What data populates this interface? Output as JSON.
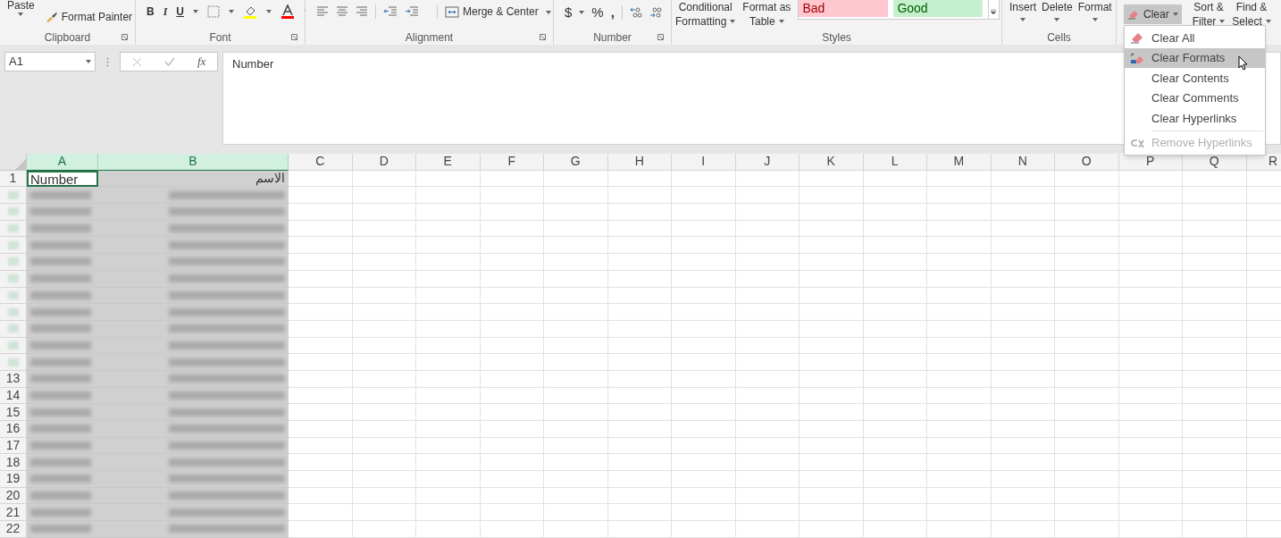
{
  "ribbon": {
    "clipboard": {
      "paste": "Paste",
      "format_painter": "Format Painter",
      "label": "Clipboard"
    },
    "font": {
      "bold": "B",
      "italic": "I",
      "underline": "U",
      "label": "Font"
    },
    "alignment": {
      "merge": "Merge & Center",
      "label": "Alignment"
    },
    "number": {
      "currency": "$",
      "percent": "%",
      "comma": ",",
      "label": "Number"
    },
    "styles": {
      "conditional": [
        "Conditional",
        "Formatting"
      ],
      "format_table": [
        "Format as",
        "Table"
      ],
      "cell_styles": [
        {
          "label": "Bad",
          "kind": "bad"
        },
        {
          "label": "Good",
          "kind": "good"
        }
      ],
      "label": "Styles"
    },
    "cells": {
      "buttons": [
        "Insert",
        "Delete",
        "Format"
      ],
      "label": "Cells"
    },
    "editing": {
      "clear": "Clear",
      "sort": [
        "Sort &",
        "Filter"
      ],
      "find": [
        "Find &",
        "Select"
      ]
    }
  },
  "formula_bar": {
    "name_box": "A1",
    "fx": "fx",
    "formula": "Number"
  },
  "clear_menu": [
    {
      "label": "Clear All",
      "selected": false,
      "disabled": false
    },
    {
      "label": "Clear Formats",
      "selected": true,
      "disabled": false
    },
    {
      "label": "Clear Contents",
      "selected": false,
      "disabled": false
    },
    {
      "label": "Clear Comments",
      "selected": false,
      "disabled": false
    },
    {
      "label": "Clear Hyperlinks",
      "selected": false,
      "disabled": false
    },
    {
      "label": "Remove Hyperlinks",
      "selected": false,
      "disabled": true
    }
  ],
  "sheet": {
    "columns": [
      {
        "label": "A",
        "selected": true
      },
      {
        "label": "B",
        "selected": true
      },
      {
        "label": "C",
        "selected": false
      },
      {
        "label": "D",
        "selected": false
      },
      {
        "label": "E",
        "selected": false
      },
      {
        "label": "F",
        "selected": false
      },
      {
        "label": "G",
        "selected": false
      },
      {
        "label": "H",
        "selected": false
      },
      {
        "label": "I",
        "selected": false
      },
      {
        "label": "J",
        "selected": false
      },
      {
        "label": "K",
        "selected": false
      },
      {
        "label": "L",
        "selected": false
      },
      {
        "label": "M",
        "selected": false
      },
      {
        "label": "N",
        "selected": false
      },
      {
        "label": "O",
        "selected": false
      },
      {
        "label": "P",
        "selected": false
      },
      {
        "label": "Q",
        "selected": false
      },
      {
        "label": "R",
        "selected": false
      }
    ],
    "rows": [
      {
        "number": "1",
        "redacted": false,
        "cells": [
          "Number",
          "الاسم"
        ]
      },
      {
        "redacted": true
      },
      {
        "redacted": true
      },
      {
        "redacted": true
      },
      {
        "redacted": true
      },
      {
        "redacted": true
      },
      {
        "redacted": true
      },
      {
        "redacted": true
      },
      {
        "redacted": true
      },
      {
        "redacted": true
      },
      {
        "redacted": true
      },
      {
        "redacted": true
      },
      {
        "number": "13",
        "redacted": true
      },
      {
        "number": "14",
        "redacted": true
      },
      {
        "number": "15",
        "redacted": true
      },
      {
        "number": "16",
        "redacted": true
      },
      {
        "number": "17",
        "redacted": true
      },
      {
        "number": "18",
        "redacted": true
      },
      {
        "number": "19",
        "redacted": true
      },
      {
        "number": "20",
        "redacted": true
      },
      {
        "number": "21",
        "redacted": true
      },
      {
        "number": "22",
        "redacted": true
      }
    ]
  }
}
